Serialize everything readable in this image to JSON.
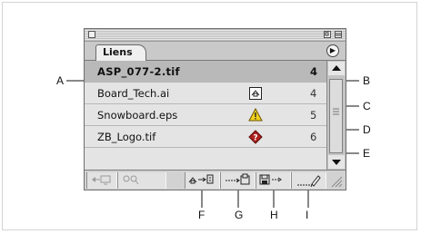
{
  "panel": {
    "tab_label": "Liens",
    "menu_glyph": "▶"
  },
  "links": [
    {
      "name": "ASP_077-2.tif",
      "page": "4",
      "status_icon": null,
      "selected": true
    },
    {
      "name": "Board_Tech.ai",
      "page": "4",
      "status_icon": "modified-icon",
      "selected": false
    },
    {
      "name": "Snowboard.eps",
      "page": "5",
      "status_icon": "warning-triangle-icon",
      "selected": false
    },
    {
      "name": "ZB_Logo.tif",
      "page": "6",
      "status_icon": "missing-link-icon",
      "selected": false
    }
  ],
  "toolbar_icons": [
    "goto-page-icon",
    "zoom-search-icon",
    "relink-icon",
    "goto-link-icon",
    "update-link-icon",
    "edit-original-icon"
  ],
  "callouts": {
    "A": "A",
    "B": "B",
    "C": "C",
    "D": "D",
    "E": "E",
    "F": "F",
    "G": "G",
    "H": "H",
    "I": "I"
  },
  "colors": {
    "selected_row": "#b9b9b9",
    "warning_yellow": "#f2d21e",
    "missing_red": "#b0201c"
  }
}
